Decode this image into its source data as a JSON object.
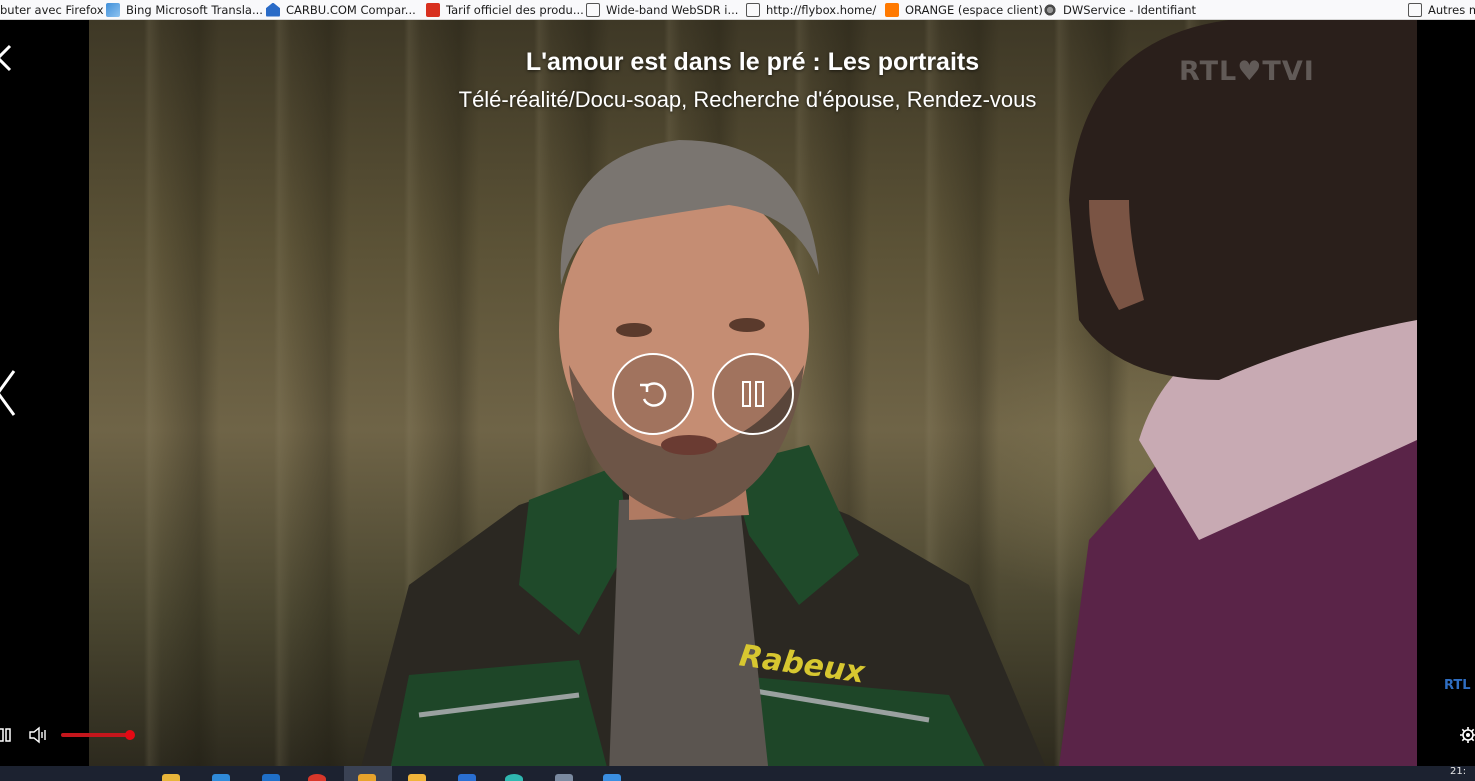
{
  "bookmarks": {
    "items": [
      {
        "label": "buter avec Firefox",
        "icon": "none"
      },
      {
        "label": "Bing Microsoft Transla...",
        "icon": "bing-icon"
      },
      {
        "label": "CARBU.COM Compar...",
        "icon": "carbu-icon"
      },
      {
        "label": "Tarif officiel des produ...",
        "icon": "tarif-icon"
      },
      {
        "label": "Wide-band WebSDR i...",
        "icon": "globe-icon"
      },
      {
        "label": "http://flybox.home/",
        "icon": "globe-icon"
      },
      {
        "label": "ORANGE (espace client)",
        "icon": "orange-icon"
      },
      {
        "label": "DWService - Identifiant",
        "icon": "dwservice-icon"
      }
    ],
    "other_label": "Autres m"
  },
  "player": {
    "title": "L'amour est dans le pré : Les portraits",
    "subtitle": "Télé-réalité/Docu-soap, Recherche d'épouse, Rendez-vous",
    "watermark": "RTL♥TVI",
    "corner_logo": "RTL",
    "jacket_text": "Rabeux",
    "volume_level": 1.0,
    "accent_color": "#e50914"
  },
  "taskbar": {
    "clock": "21:"
  }
}
